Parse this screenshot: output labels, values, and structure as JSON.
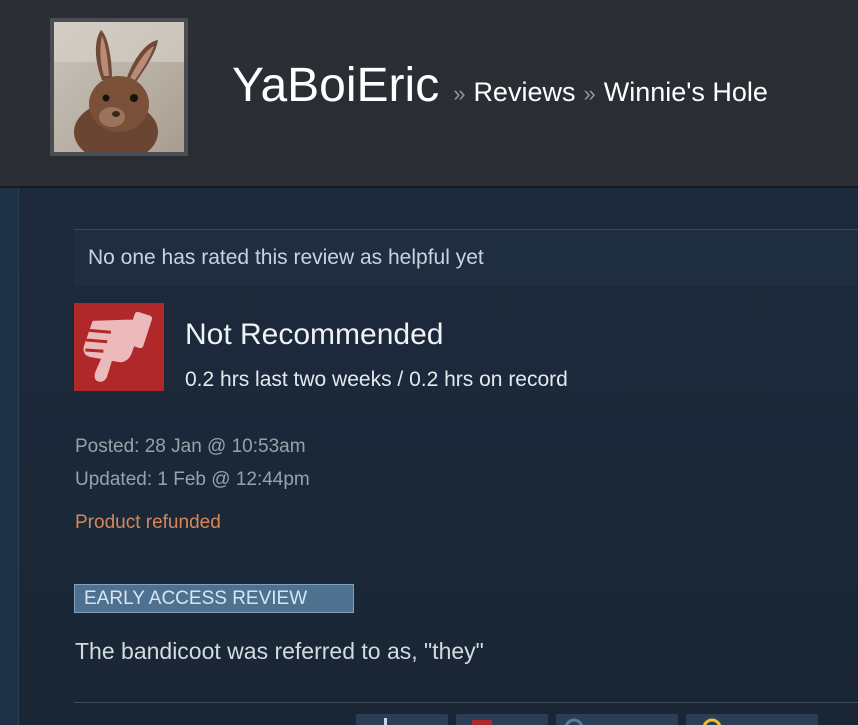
{
  "header": {
    "username": "YaBoiEric",
    "sep1": "»",
    "reviews_link": "Reviews",
    "sep2": "»",
    "game_link": "Winnie's Hole"
  },
  "review": {
    "helpful_text": "No one has rated this review as helpful yet",
    "recommendation": "Not Recommended",
    "recommendation_icon": "thumbs-down-icon",
    "hours": "0.2 hrs last two weeks / 0.2 hrs on record",
    "posted": "Posted: 28 Jan @ 10:53am",
    "updated": "Updated: 1 Feb @ 12:44pm",
    "refund_status": "Product refunded",
    "badge": "EARLY ACCESS REVIEW",
    "body": "The bandicoot was referred to as, \"they\""
  },
  "vote_buttons": [
    "thumbs-up-icon",
    "thumbs-down-icon",
    "funny-icon",
    "award-icon"
  ],
  "colors": {
    "background": "#1b2838",
    "header": "#2b2e35",
    "thumb_down_bg": "#b0282a",
    "refund": "#d6875a",
    "badge_bg": "#4f7190"
  }
}
